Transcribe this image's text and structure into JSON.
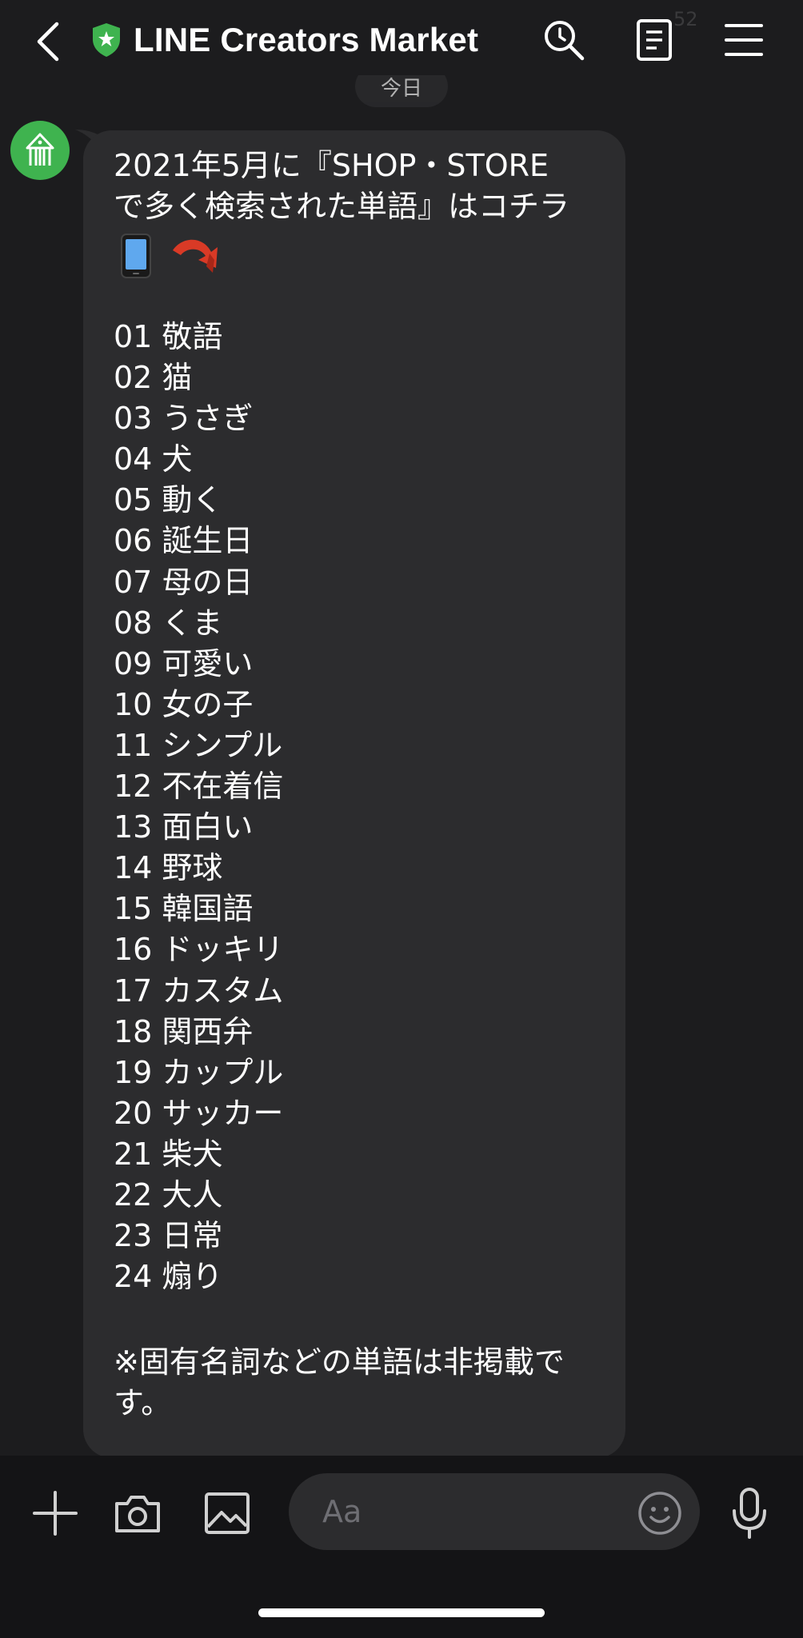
{
  "header": {
    "title": "LINE Creators Market",
    "status_time": "52"
  },
  "date_chip": "今日",
  "message": {
    "intro_line1": "2021年5月に『SHOP・STORE",
    "intro_line2": "で多く検索された単語』はコチラ",
    "emoji": [
      "mobile-phone-icon",
      "red-arrow-icon"
    ],
    "ranking": [
      "01 敬語",
      "02 猫",
      "03 うさぎ",
      "04 犬",
      "05 動く",
      "06 誕生日",
      "07 母の日",
      "08 くま",
      "09 可愛い",
      "10 女の子",
      "11 シンプル",
      "12 不在着信",
      "13 面白い",
      "14 野球",
      "15 韓国語",
      "16 ドッキリ",
      "17 カスタム",
      "18 関西弁",
      "19 カップル",
      "20 サッカー",
      "21 柴犬",
      "22 大人",
      "23 日常",
      "24 煽り"
    ],
    "note_line1": "※固有名詞などの単語は非掲載で",
    "note_line2": "す。"
  },
  "composer": {
    "placeholder": "Aa"
  },
  "colors": {
    "background": "#1c1c1e",
    "bubble": "#2c2c2e",
    "composer": "#141416",
    "avatar": "#3fb34f",
    "shield": "#3fb34f"
  }
}
